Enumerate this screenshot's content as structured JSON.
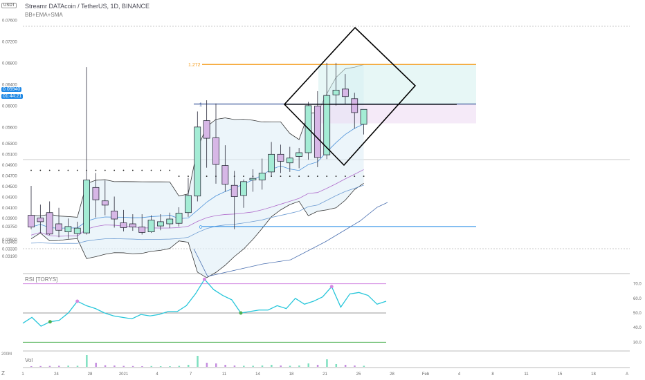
{
  "header": {
    "title": "Streamr DATAcoin / TetherUS, 1D, BINANCE",
    "indicator": "BB+EMA+SMA",
    "currency": "USDT"
  },
  "price_tag": {
    "price": "0.05940",
    "countdown": "01:44:21"
  },
  "rsi_label": "RSI [TORYS]",
  "vol_label": "Vol",
  "vol_tick": "200M",
  "bottom_letters": [
    "Z",
    "A"
  ],
  "colors": {
    "up": "#a4ecd5",
    "down": "#d7b7e6",
    "outline": "#2b2b3b",
    "fib": "#f59b1a",
    "fib_zero": "#1e88e5",
    "rsi": "#26c6da",
    "rsi_upper": "#d28ae2",
    "rsi_lower": "#4caf50",
    "sma": "#b06ccc"
  },
  "chart_data": [
    {
      "type": "candlestick",
      "title": "Streamr DATAcoin / TetherUS, 1D, BINANCE",
      "x_tick_labels": [
        "1",
        "24",
        "28",
        "2021",
        "4",
        "7",
        "11",
        "14",
        "18",
        "21",
        "25",
        "28",
        "Feb",
        "4",
        "8",
        "11",
        "15",
        "18",
        "A"
      ],
      "y_tick_labels": [
        "0.07600",
        "0.07200",
        "0.06800",
        "0.06400",
        "0.06000",
        "0.05600",
        "0.05300",
        "0.05100",
        "0.04900",
        "0.04700",
        "0.04500",
        "0.04300",
        "0.04100",
        "0.03900",
        "0.03750",
        "0.03500",
        "0.03460",
        "0.03330",
        "0.03190"
      ],
      "ohlc": [
        {
          "o": 0.0396,
          "h": 0.0451,
          "l": 0.037,
          "c": 0.0374
        },
        {
          "o": 0.0391,
          "h": 0.0416,
          "l": 0.0363,
          "c": 0.0384
        },
        {
          "o": 0.0401,
          "h": 0.0422,
          "l": 0.0359,
          "c": 0.0361
        },
        {
          "o": 0.038,
          "h": 0.041,
          "l": 0.0355,
          "c": 0.0368
        },
        {
          "o": 0.0365,
          "h": 0.039,
          "l": 0.0352,
          "c": 0.0375
        },
        {
          "o": 0.0362,
          "h": 0.0384,
          "l": 0.0353,
          "c": 0.0372
        },
        {
          "o": 0.0363,
          "h": 0.0673,
          "l": 0.036,
          "c": 0.0462
        },
        {
          "o": 0.0448,
          "h": 0.0475,
          "l": 0.0392,
          "c": 0.0425
        },
        {
          "o": 0.0423,
          "h": 0.0461,
          "l": 0.0396,
          "c": 0.0415
        },
        {
          "o": 0.0404,
          "h": 0.0431,
          "l": 0.0373,
          "c": 0.0389
        },
        {
          "o": 0.0382,
          "h": 0.0406,
          "l": 0.0366,
          "c": 0.0373
        },
        {
          "o": 0.038,
          "h": 0.0398,
          "l": 0.0367,
          "c": 0.0374
        },
        {
          "o": 0.0374,
          "h": 0.0398,
          "l": 0.036,
          "c": 0.0364
        },
        {
          "o": 0.0365,
          "h": 0.0396,
          "l": 0.0363,
          "c": 0.0387
        },
        {
          "o": 0.0376,
          "h": 0.0398,
          "l": 0.0368,
          "c": 0.0384
        },
        {
          "o": 0.038,
          "h": 0.0401,
          "l": 0.0372,
          "c": 0.0389
        },
        {
          "o": 0.0381,
          "h": 0.0411,
          "l": 0.0375,
          "c": 0.04
        },
        {
          "o": 0.0401,
          "h": 0.0466,
          "l": 0.0393,
          "c": 0.0433
        },
        {
          "o": 0.0432,
          "h": 0.059,
          "l": 0.0422,
          "c": 0.0561
        },
        {
          "o": 0.0573,
          "h": 0.0611,
          "l": 0.0485,
          "c": 0.054
        },
        {
          "o": 0.0541,
          "h": 0.0605,
          "l": 0.0455,
          "c": 0.0491
        },
        {
          "o": 0.0489,
          "h": 0.0527,
          "l": 0.044,
          "c": 0.0454
        },
        {
          "o": 0.0452,
          "h": 0.0479,
          "l": 0.037,
          "c": 0.0431
        },
        {
          "o": 0.0433,
          "h": 0.0463,
          "l": 0.041,
          "c": 0.0459
        },
        {
          "o": 0.0462,
          "h": 0.0482,
          "l": 0.044,
          "c": 0.0465
        },
        {
          "o": 0.0462,
          "h": 0.0502,
          "l": 0.0444,
          "c": 0.0475
        },
        {
          "o": 0.0477,
          "h": 0.0533,
          "l": 0.0469,
          "c": 0.051
        },
        {
          "o": 0.051,
          "h": 0.0528,
          "l": 0.0475,
          "c": 0.0497
        },
        {
          "o": 0.0494,
          "h": 0.0524,
          "l": 0.0477,
          "c": 0.0503
        },
        {
          "o": 0.0506,
          "h": 0.0522,
          "l": 0.0484,
          "c": 0.0513
        },
        {
          "o": 0.0513,
          "h": 0.0608,
          "l": 0.05,
          "c": 0.0601
        },
        {
          "o": 0.06,
          "h": 0.0628,
          "l": 0.0486,
          "c": 0.0504
        },
        {
          "o": 0.0509,
          "h": 0.0681,
          "l": 0.0501,
          "c": 0.062
        },
        {
          "o": 0.0621,
          "h": 0.0681,
          "l": 0.0601,
          "c": 0.063
        },
        {
          "o": 0.0632,
          "h": 0.066,
          "l": 0.0603,
          "c": 0.0618
        },
        {
          "o": 0.0614,
          "h": 0.0625,
          "l": 0.0558,
          "c": 0.0588
        },
        {
          "o": 0.0566,
          "h": 0.0593,
          "l": 0.0547,
          "c": 0.0594
        }
      ],
      "fib_levels": [
        {
          "label": "1.272",
          "value": 0.0678
        },
        {
          "label": "1",
          "value": 0.0604
        },
        {
          "label": "0",
          "value": 0.0375
        }
      ],
      "rsi": {
        "y_tick_labels": [
          "70.0",
          "60.0",
          "50.0",
          "40.0",
          "30.0"
        ],
        "upper": 70,
        "middle": 50,
        "lower": 30,
        "values": [
          43,
          47,
          41,
          44,
          45,
          50,
          58,
          55,
          53,
          50,
          48,
          47,
          46,
          49,
          48,
          49,
          51,
          51,
          55,
          63,
          73,
          66,
          62,
          59,
          50,
          51,
          52,
          52,
          55,
          53,
          60,
          56,
          58,
          61,
          68,
          54,
          63,
          64,
          62,
          56,
          58
        ]
      },
      "volume": {
        "values": [
          0.05,
          0.06,
          0.07,
          0.08,
          0.09,
          0.08,
          0.85,
          0.3,
          0.12,
          0.1,
          0.07,
          0.06,
          0.05,
          0.06,
          0.05,
          0.05,
          0.07,
          0.15,
          0.8,
          0.3,
          0.25,
          0.15,
          0.1,
          0.08,
          0.08,
          0.1,
          0.15,
          0.1,
          0.08,
          0.1,
          0.25,
          0.15,
          0.55,
          0.2,
          0.15,
          0.1,
          0.08
        ]
      }
    }
  ]
}
